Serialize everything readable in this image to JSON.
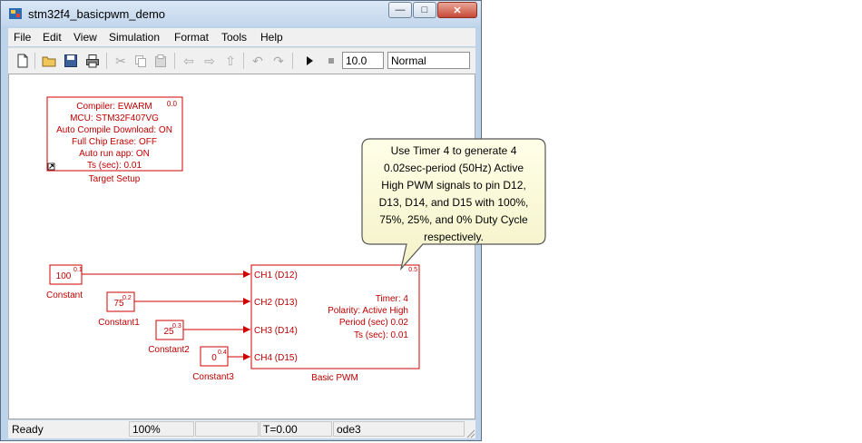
{
  "window": {
    "title": "stm32f4_basicpwm_demo",
    "minimize": "—",
    "maximize": "□",
    "close": "✕"
  },
  "menu": [
    "File",
    "Edit",
    "View",
    "Simulation",
    "Format",
    "Tools",
    "Help"
  ],
  "toolbar": {
    "icons": [
      "new-icon",
      "open-icon",
      "save-icon",
      "print-icon",
      "cut-icon",
      "copy-icon",
      "paste-icon",
      "back-icon",
      "forward-icon",
      "up-icon",
      "undo-icon",
      "redo-icon",
      "play-icon",
      "stop-icon"
    ],
    "stop_time": "10.0",
    "sim_mode": "Normal"
  },
  "target_setup": {
    "lines": [
      "Compiler: EWARM",
      "MCU: STM32F407VG",
      "Auto Compile Download: ON",
      "Full Chip Erase: OFF",
      "Auto run app: ON",
      "Ts (sec): 0.01"
    ],
    "corner": "0.0",
    "label": "Target Setup"
  },
  "constants": [
    {
      "value": "100",
      "corner": "0.1",
      "label": "Constant"
    },
    {
      "value": "75",
      "corner": "0.2",
      "label": "Constant1"
    },
    {
      "value": "25",
      "corner": "0.3",
      "label": "Constant2"
    },
    {
      "value": "0",
      "corner": "0.4",
      "label": "Constant3"
    }
  ],
  "pwm_block": {
    "ports": [
      "CH1 (D12)",
      "CH2 (D13)",
      "CH3 (D14)",
      "CH4 (D15)"
    ],
    "params": [
      "Timer: 4",
      "Polarity: Active High",
      "Period (sec) 0.02",
      "Ts (sec): 0.01"
    ],
    "corner": "0.5",
    "label": "Basic PWM"
  },
  "callout": {
    "lines": [
      "Use Timer 4 to generate 4",
      "0.02sec-period (50Hz) Active",
      "High PWM signals to pin D12,",
      "D13, D14, and D15 with 100%,",
      "75%, 25%, and 0% Duty Cycle",
      "respectively."
    ]
  },
  "status": {
    "ready": "Ready",
    "zoom": "100%",
    "empty": "",
    "time": "T=0.00",
    "solver": "ode3"
  },
  "colors": {
    "block": "#d00000",
    "callout_bg": "#ffffe1"
  }
}
